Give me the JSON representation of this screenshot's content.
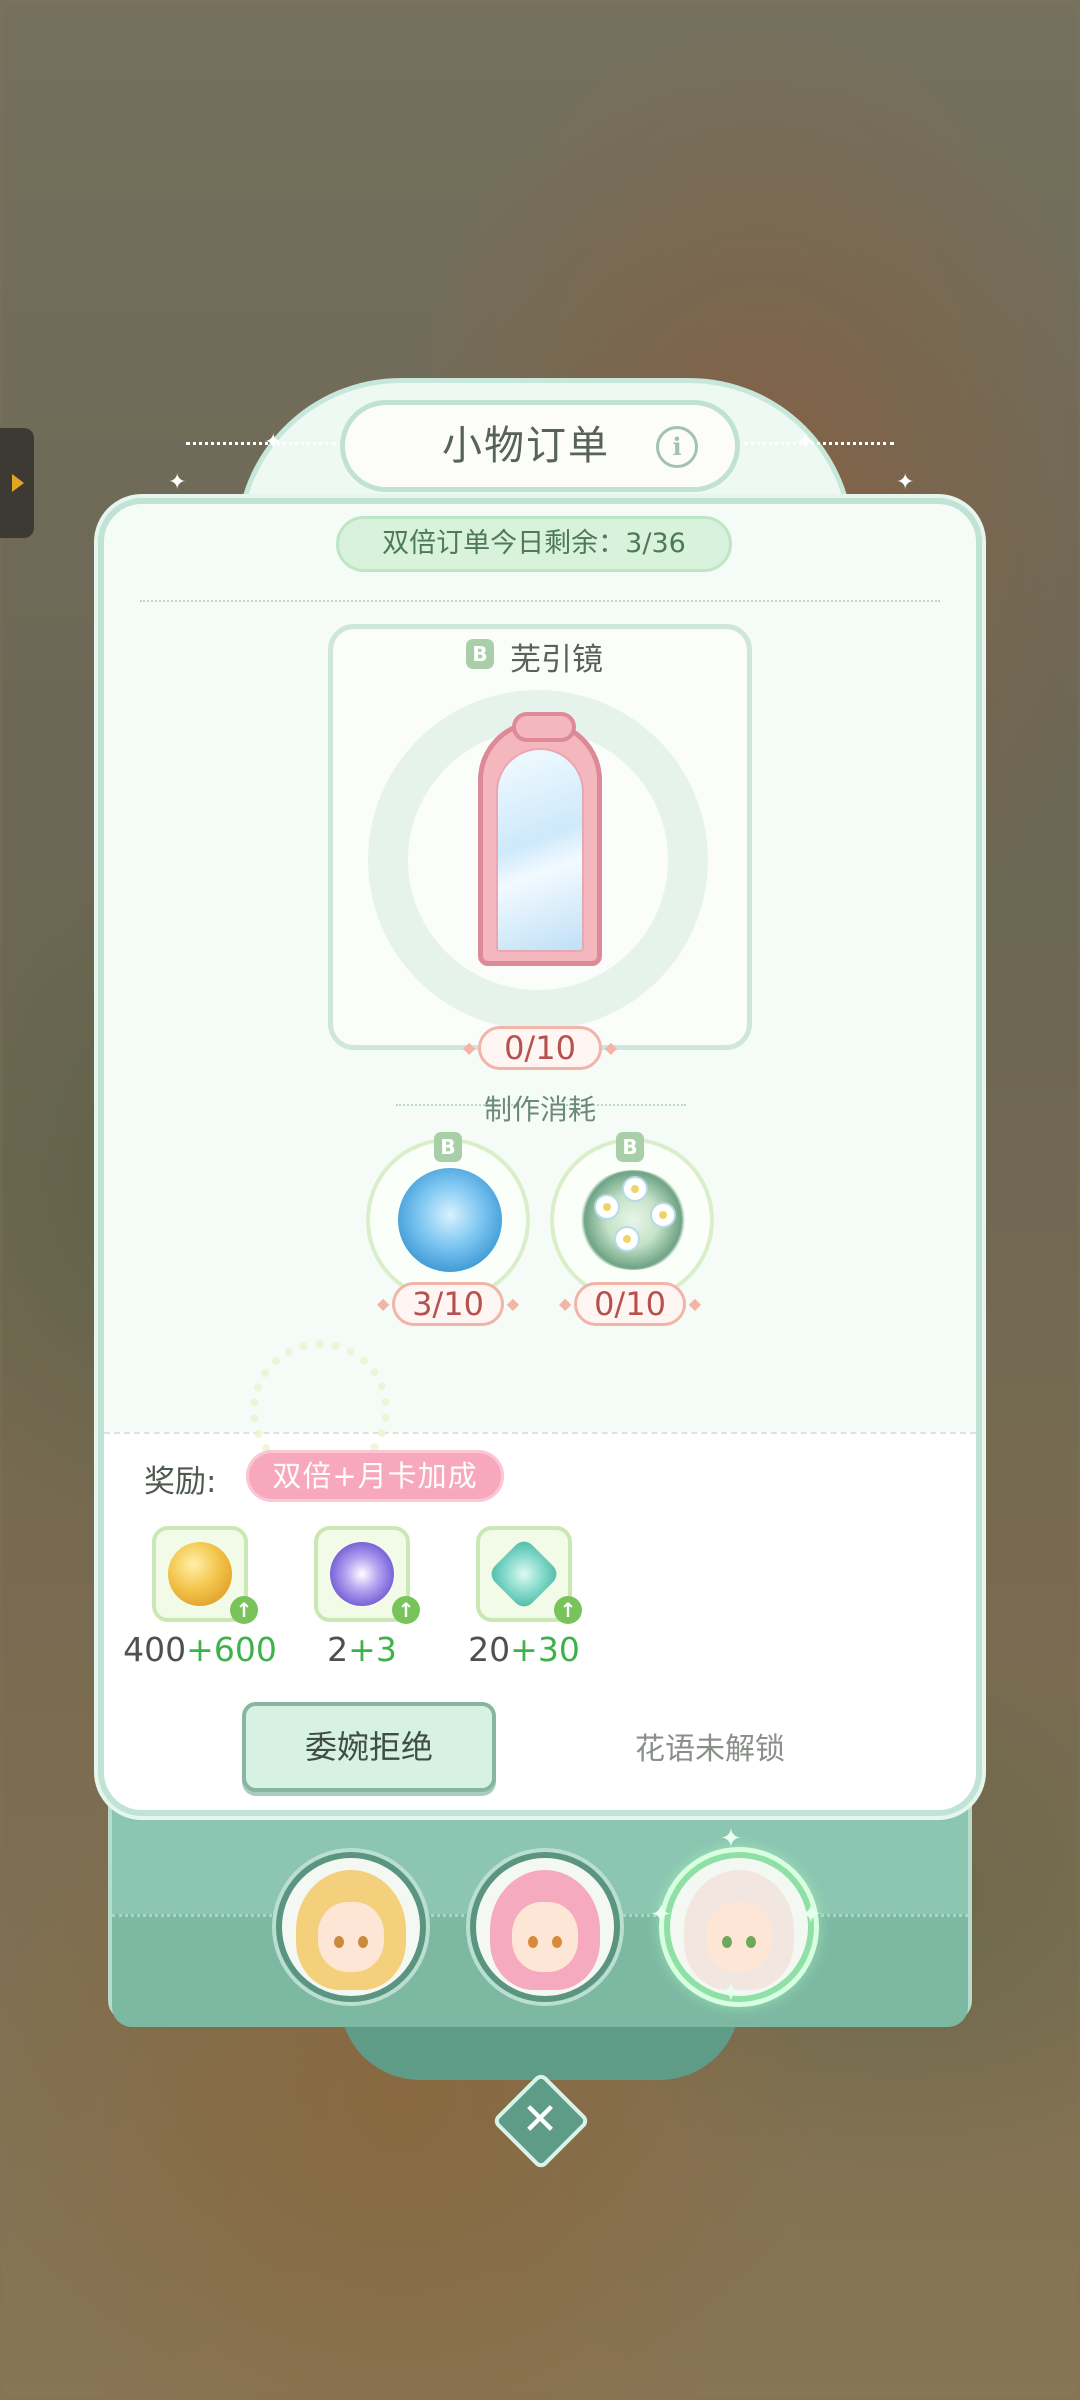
{
  "title": "小物订单",
  "double_order": "双倍订单今日剩余：3/36",
  "item": {
    "grade": "B",
    "name": "芜引镜",
    "count": "0/10"
  },
  "craft": {
    "label": "制作消耗",
    "materials": [
      {
        "grade": "B",
        "icon": "blue-flower-icon",
        "count": "3/10"
      },
      {
        "grade": "B",
        "icon": "white-flower-icon",
        "count": "0/10"
      }
    ]
  },
  "rewards": {
    "label": "奖励:",
    "bonus_tag": "双倍+月卡加成",
    "items": [
      {
        "icon": "gold-coin-icon",
        "base": "400",
        "bonus": "+600"
      },
      {
        "icon": "crystal-token-icon",
        "base": "2",
        "bonus": "+3"
      },
      {
        "icon": "exp-star-icon",
        "base": "20",
        "bonus": "+30"
      }
    ]
  },
  "buttons": {
    "decline": "委婉拒绝",
    "locked": "花语未解锁"
  },
  "colors": {
    "accent": "#8cc5b1",
    "bonus_text": "#3fb14b",
    "count_text": "#b5514e",
    "bonus_tag": "#f7a8bd"
  }
}
